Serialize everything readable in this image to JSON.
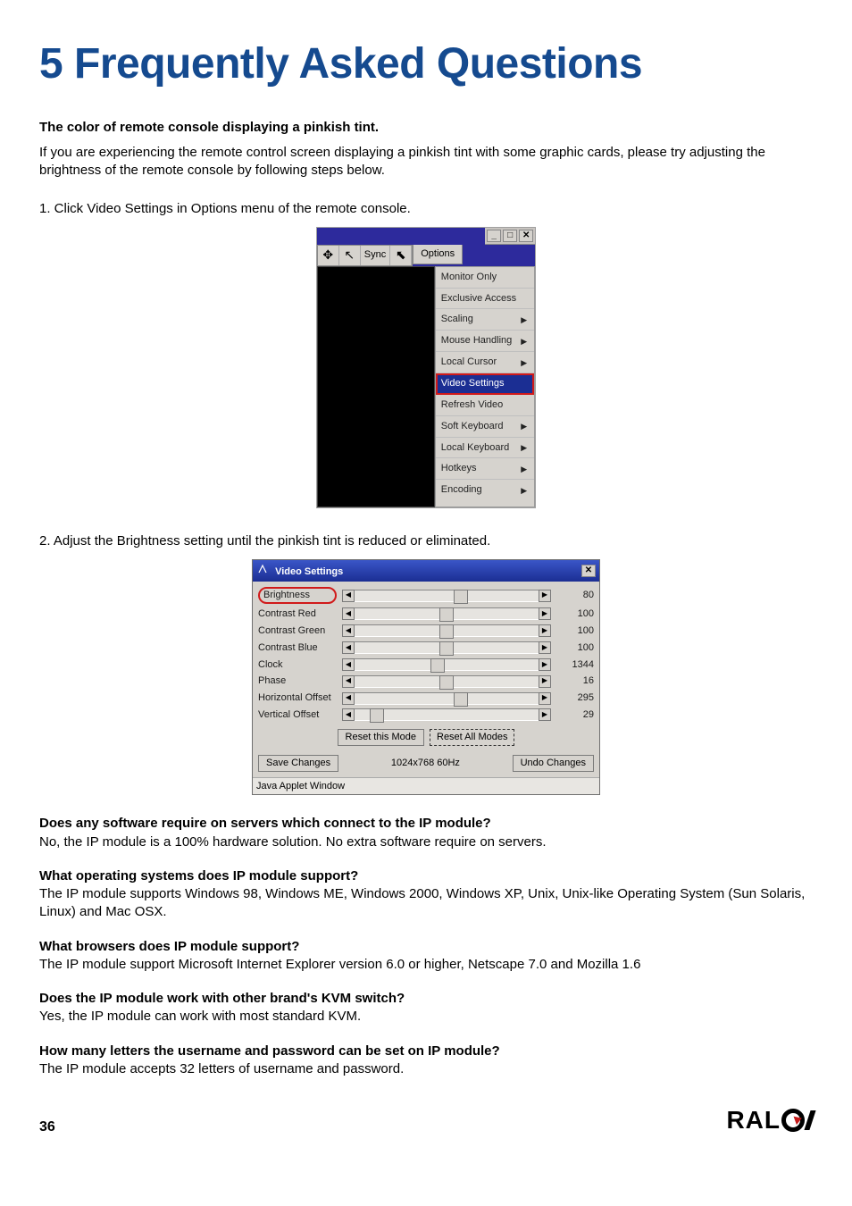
{
  "page": {
    "title": "5  Frequently Asked Questions",
    "number": "36",
    "brand": "RALOY"
  },
  "intro": {
    "heading": "The color of remote console displaying a pinkish tint.",
    "body": "If you are experiencing the remote control screen displaying a pinkish tint with some graphic cards, please try adjusting the brightness of the remote console by following steps below."
  },
  "steps": {
    "s1": "1.  Click Video Settings in Options menu of the remote console.",
    "s2": "2.  Adjust the Brightness setting until the pinkish tint is reduced or eliminated."
  },
  "options_menu": {
    "toolbar": {
      "sync": "Sync"
    },
    "button": "Options",
    "items": [
      {
        "label": "Monitor Only",
        "submenu": false
      },
      {
        "label": "Exclusive Access",
        "submenu": false
      },
      {
        "label": "Scaling",
        "submenu": true
      },
      {
        "label": "Mouse Handling",
        "submenu": true
      },
      {
        "label": "Local Cursor",
        "submenu": true
      },
      {
        "label": "Video Settings",
        "submenu": false,
        "selected": true
      },
      {
        "label": "Refresh Video",
        "submenu": false
      },
      {
        "label": "Soft Keyboard",
        "submenu": true
      },
      {
        "label": "Local Keyboard",
        "submenu": true
      },
      {
        "label": "Hotkeys",
        "submenu": true
      },
      {
        "label": "Encoding",
        "submenu": true
      }
    ],
    "winbtns": {
      "min": "_",
      "max": "□",
      "close": "✕"
    }
  },
  "video_settings": {
    "title": "Video Settings",
    "rows": [
      {
        "label": "Brightness",
        "value": "80",
        "pos": 58,
        "circled": true
      },
      {
        "label": "Contrast Red",
        "value": "100",
        "pos": 50
      },
      {
        "label": "Contrast Green",
        "value": "100",
        "pos": 50
      },
      {
        "label": "Contrast Blue",
        "value": "100",
        "pos": 50
      },
      {
        "label": "Clock",
        "value": "1344",
        "pos": 45
      },
      {
        "label": "Phase",
        "value": "16",
        "pos": 50
      },
      {
        "label": "Horizontal Offset",
        "value": "295",
        "pos": 58
      },
      {
        "label": "Vertical Offset",
        "value": "29",
        "pos": 12
      }
    ],
    "reset_this": "Reset this Mode",
    "reset_all": "Reset All Modes",
    "save": "Save Changes",
    "mode": "1024x768 60Hz",
    "undo": "Undo Changes",
    "status": "Java Applet Window"
  },
  "faq": [
    {
      "q": "Does any software require on servers which connect to the IP module?",
      "a": "No, the IP module is a 100% hardware solution. No extra software require on servers."
    },
    {
      "q": "What operating systems does IP module support?",
      "a": "The IP module supports Windows 98, Windows ME, Windows 2000, Windows XP, Unix, Unix-like Operating System (Sun Solaris, Linux) and Mac OSX."
    },
    {
      "q": "What browsers does IP module support?",
      "a": "The IP module support Microsoft Internet Explorer version 6.0 or higher, Netscape 7.0 and Mozilla 1.6"
    },
    {
      "q": "Does the IP module work with other brand's KVM switch?",
      "a": "Yes, the IP module can work with most standard KVM."
    },
    {
      "q": "How many letters the username and password can be set on IP module?",
      "a": "The IP module accepts 32 letters of username and password."
    }
  ]
}
